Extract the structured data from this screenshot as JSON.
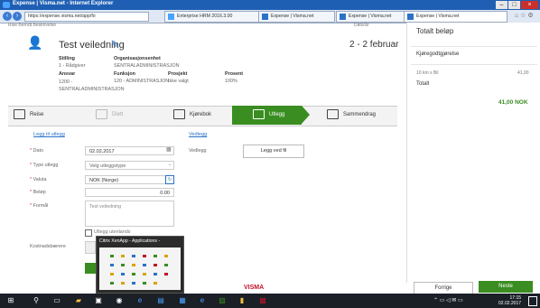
{
  "browser": {
    "title": "Expense | Visma.net - Internet Explorer",
    "url": "https://expense.visma.net/app/fo",
    "tabs": [
      {
        "label": "Enterprise HRM 2016.3.00"
      },
      {
        "label": "Expense | Visma.net"
      },
      {
        "label": "Expense | Visma.net"
      },
      {
        "label": "Expense | Visma.net"
      }
    ]
  },
  "header": {
    "person_labels_cut": "Rise Berndt     Beskrivelse",
    "date_label_cut": "Dato/år",
    "title": "Test veiledning",
    "date": "2 - 2 februar",
    "stilling_label": "Stilling",
    "stilling_value": "1 - Rådgiver",
    "org_label": "Organisasjonsenhet",
    "org_value": "SENTRALADMINISTRASJON",
    "ansvar_label": "Ansvar",
    "ansvar_value": "1200 - SENTRALADMINISTRASJON",
    "funksjon_label": "Funksjon",
    "funksjon_value": "120 - ADMINISTRASJON",
    "prosjekt_label": "Prosjekt",
    "prosjekt_value": "Ikke valgt",
    "prosent_label": "Prosent",
    "prosent_value": "100%"
  },
  "steps": [
    {
      "label": "Reise"
    },
    {
      "label": "Diett"
    },
    {
      "label": "Kjørebok"
    },
    {
      "label": "Utlegg"
    },
    {
      "label": "Sammendrag"
    }
  ],
  "form": {
    "section": "Legg til utlegg",
    "dato_label": "Dato",
    "dato_value": "02.02.2017",
    "type_label": "Type utlegg",
    "type_value": "Velg utleggstype",
    "valuta_label": "Valuta",
    "valuta_value": "NOK (Norge)",
    "belop_label": "Beløp",
    "belop_value": "0.00",
    "formal_label": "Formål",
    "formal_value": "Test veiledning",
    "kostnad_label": "Kostnadsbærere",
    "checkbox_label": "Utlegg utenlands"
  },
  "attachments": {
    "section": "Vedlegg",
    "label": "Vedlegg",
    "button": "Legg ved fil"
  },
  "summary": {
    "total_label": "Totalt beløp",
    "kjore_label": "Kjøregodtgjørelse",
    "line1_desc": "10 km x Bil",
    "line1_amount": "41,00",
    "totalt_label": "Totalt",
    "total_amount": "41,00 NOK"
  },
  "footer": {
    "prev": "Forrige",
    "next": "Neste",
    "logo": "VISMA"
  },
  "popup": {
    "title": "Citrix XenApp - Applications -"
  },
  "taskbar": {
    "time": "17:15",
    "date": "02.02.2017"
  },
  "colors": {
    "accent_green": "#3a8d21",
    "link_blue": "#2a72c8",
    "visma_red": "#c0142a"
  }
}
